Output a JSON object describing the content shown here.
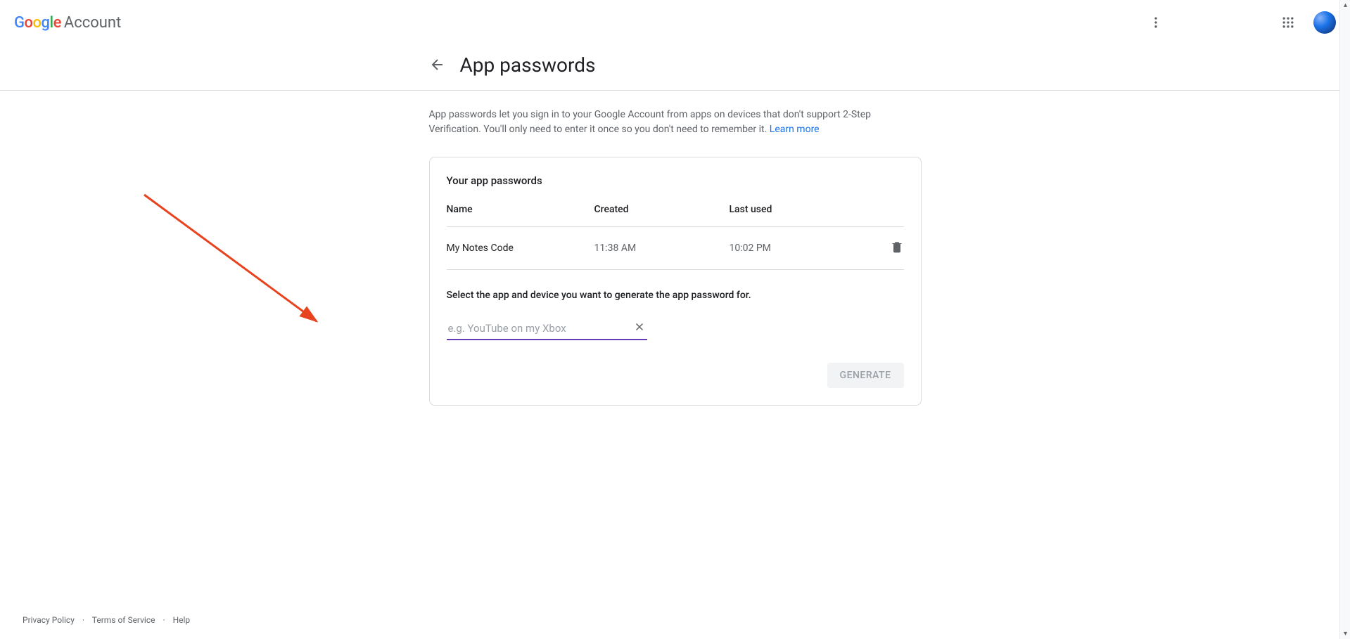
{
  "header": {
    "brand": "Google",
    "product": "Account"
  },
  "page": {
    "title": "App passwords",
    "description_part1": "App passwords let you sign in to your Google Account from apps on devices that don't support 2-Step Verification. You'll only need to enter it once so you don't need to remember it. ",
    "learn_more": "Learn more"
  },
  "card": {
    "title": "Your app passwords",
    "columns": {
      "name": "Name",
      "created": "Created",
      "last_used": "Last used"
    },
    "rows": [
      {
        "name": "My Notes Code",
        "created": "11:38 AM",
        "last_used": "10:02 PM"
      }
    ],
    "instruction": "Select the app and device you want to generate the app password for.",
    "input_placeholder": "e.g. YouTube on my Xbox",
    "input_value": "",
    "generate_label": "GENERATE"
  },
  "footer": {
    "privacy": "Privacy Policy",
    "terms": "Terms of Service",
    "help": "Help"
  }
}
